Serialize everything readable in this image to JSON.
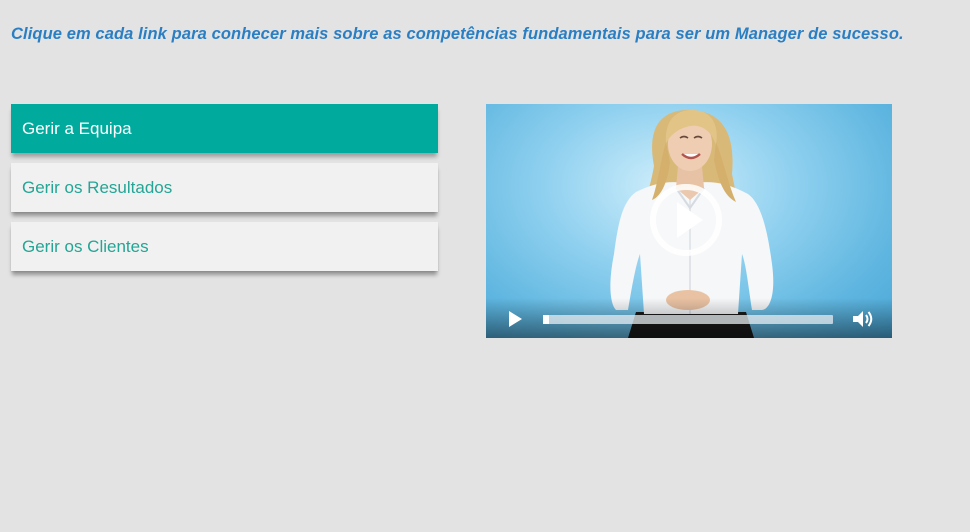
{
  "instruction": "Clique em cada link para conhecer mais sobre as competências fundamentais para ser um Manager de sucesso.",
  "menu": {
    "items": [
      {
        "label": "Gerir a Equipa",
        "active": true
      },
      {
        "label": "Gerir os Resultados",
        "active": false
      },
      {
        "label": "Gerir os Clientes",
        "active": false
      }
    ]
  },
  "video": {
    "progress": 0.02,
    "icons": {
      "overlay": "play-circle-icon",
      "play": "play-icon",
      "volume": "volume-icon"
    }
  },
  "colors": {
    "background": "#e3e3e3",
    "instruction_text": "#2a7fc4",
    "active_item_bg": "#00ab9d",
    "active_item_text": "#ffffff",
    "item_bg": "#f1f1f1",
    "item_text": "#24a595"
  }
}
